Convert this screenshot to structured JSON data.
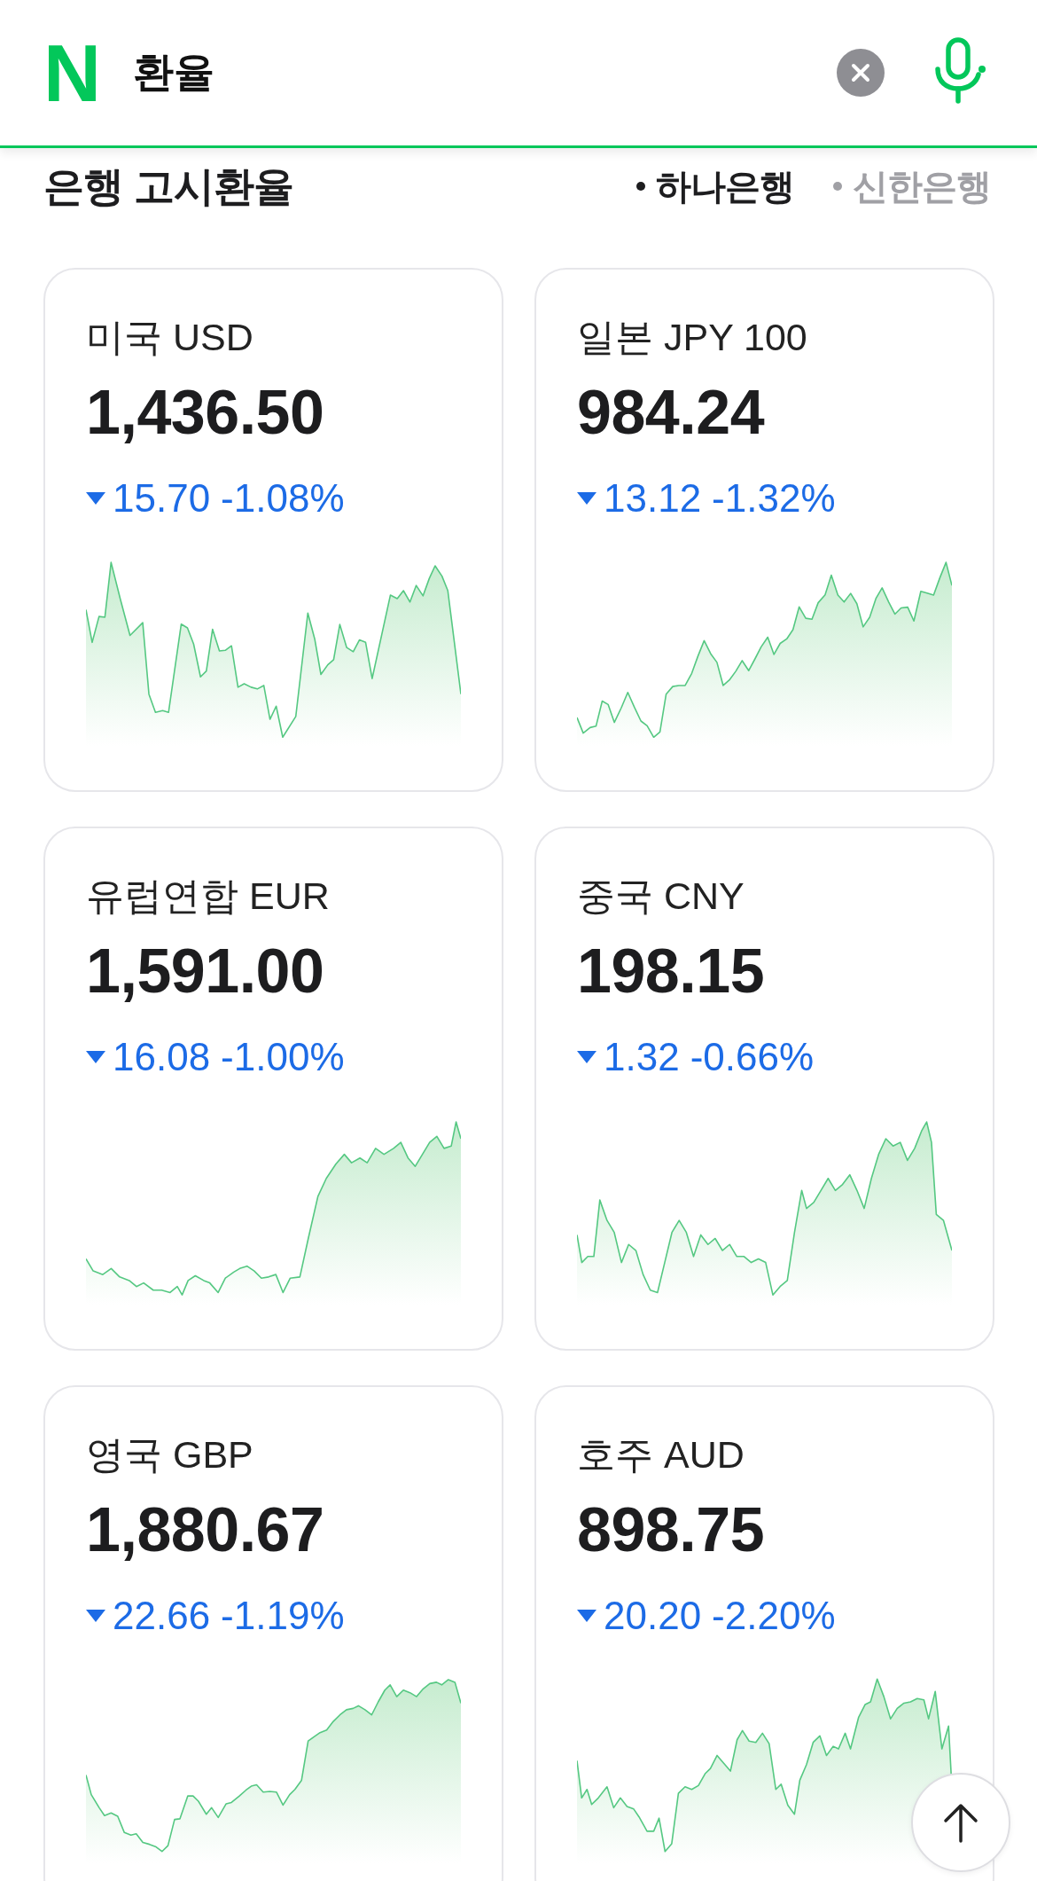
{
  "search": {
    "logo": "N",
    "value": "환율"
  },
  "section": {
    "title": "은행 고시환율",
    "banks": [
      {
        "label": "하나은행",
        "selected": true
      },
      {
        "label": "신한은행",
        "selected": false
      }
    ]
  },
  "rates": [
    {
      "currency": "미국 USD",
      "rate": "1,436.50",
      "falling": true,
      "change": "15.70",
      "percent": "-1.08%"
    },
    {
      "currency": "일본 JPY 100",
      "rate": "984.24",
      "falling": true,
      "change": "13.12",
      "percent": "-1.32%"
    },
    {
      "currency": "유럽연합 EUR",
      "rate": "1,591.00",
      "falling": true,
      "change": "16.08",
      "percent": "-1.00%"
    },
    {
      "currency": "중국 CNY",
      "rate": "198.15",
      "falling": true,
      "change": "1.32",
      "percent": "-0.66%"
    },
    {
      "currency": "영국 GBP",
      "rate": "1,880.67",
      "falling": true,
      "change": "22.66",
      "percent": "-1.19%"
    },
    {
      "currency": "호주 AUD",
      "rate": "898.75",
      "falling": true,
      "change": "20.20",
      "percent": "-2.20%"
    }
  ]
}
